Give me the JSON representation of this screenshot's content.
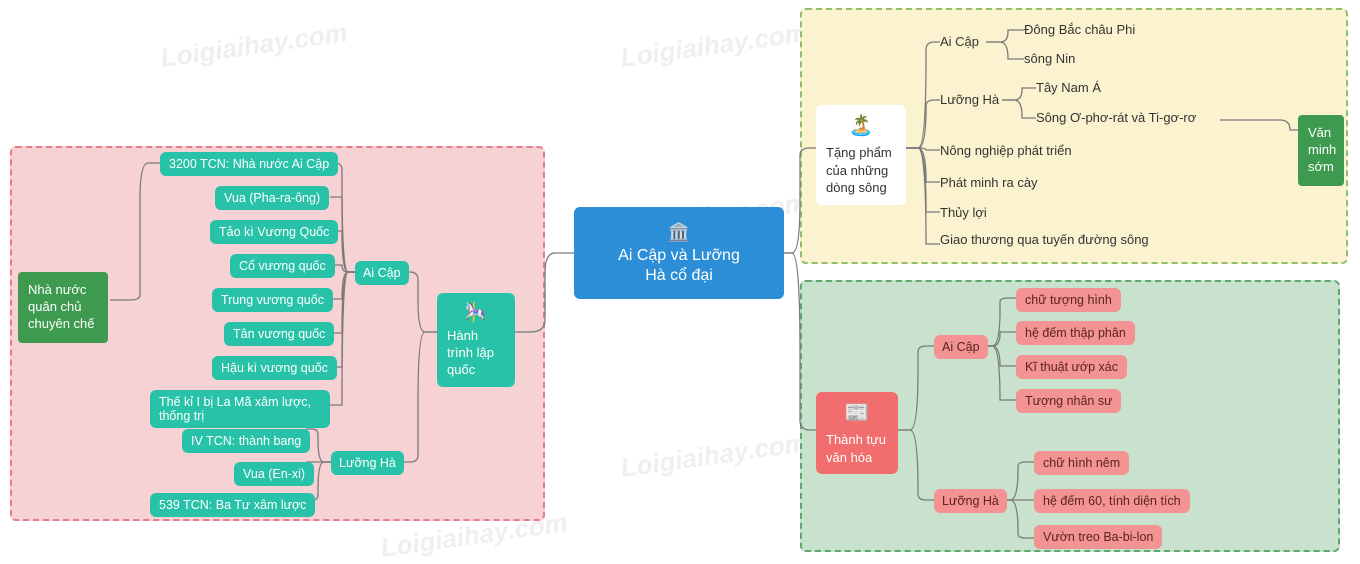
{
  "watermark": "Loigiaihay.com",
  "center": {
    "title_l1": "Ai Cập và Lưỡng",
    "title_l2": "Hà cổ đại",
    "icon": "🏛️"
  },
  "left": {
    "badge": "Nhà nước quân chủ chuyên chế",
    "journey": {
      "icon": "🎠",
      "title": "Hành trình lập quốc"
    },
    "groups": {
      "aicap": {
        "label": "Ai Cập",
        "items": [
          "3200 TCN: Nhà nước Ai Cập",
          "Vua (Pha-ra-ông)",
          "Tảo kì Vương Quốc",
          "Cổ vương quốc",
          "Trung vương quốc",
          "Tân vương quốc",
          "Hậu kì vương quốc",
          "Thế kỉ I bị La Mã xâm lược, thống trị"
        ]
      },
      "luongha": {
        "label": "Lưỡng Hà",
        "items": [
          "IV TCN: thành bang",
          "Vua (En-xi)",
          "539 TCN: Ba Tư xâm lược"
        ]
      }
    }
  },
  "top_right": {
    "badge": "Văn minh sớm",
    "rivers": {
      "icon": "🏝️",
      "title": "Tặng phẩm của những dòng sông"
    },
    "aicap": {
      "label": "Ai Cập",
      "items": [
        "Đông Bắc châu Phi",
        "sông Nin"
      ]
    },
    "luongha": {
      "label": "Lưỡng Hà",
      "items": [
        "Tây Nam Á",
        "Sông Ơ-phơ-rát và Ti-gơ-rơ"
      ]
    },
    "extras": [
      "Nông nghiệp phát triển",
      "Phát minh ra cày",
      "Thủy lợi",
      "Giao thương qua tuyến đường sông"
    ]
  },
  "bottom_right": {
    "culture": {
      "icon": "📰",
      "title": "Thành tựu văn hóa"
    },
    "aicap": {
      "label": "Ai Cập",
      "items": [
        "chữ tượng hình",
        "hệ đếm thập phân",
        "Kĩ thuật ướp xác",
        "Tượng nhân sư"
      ]
    },
    "luongha": {
      "label": "Lưỡng Hà",
      "items": [
        "chữ hình nêm",
        "hệ đếm 60, tính diện tích",
        "Vườn treo Ba-bi-lon"
      ]
    }
  }
}
